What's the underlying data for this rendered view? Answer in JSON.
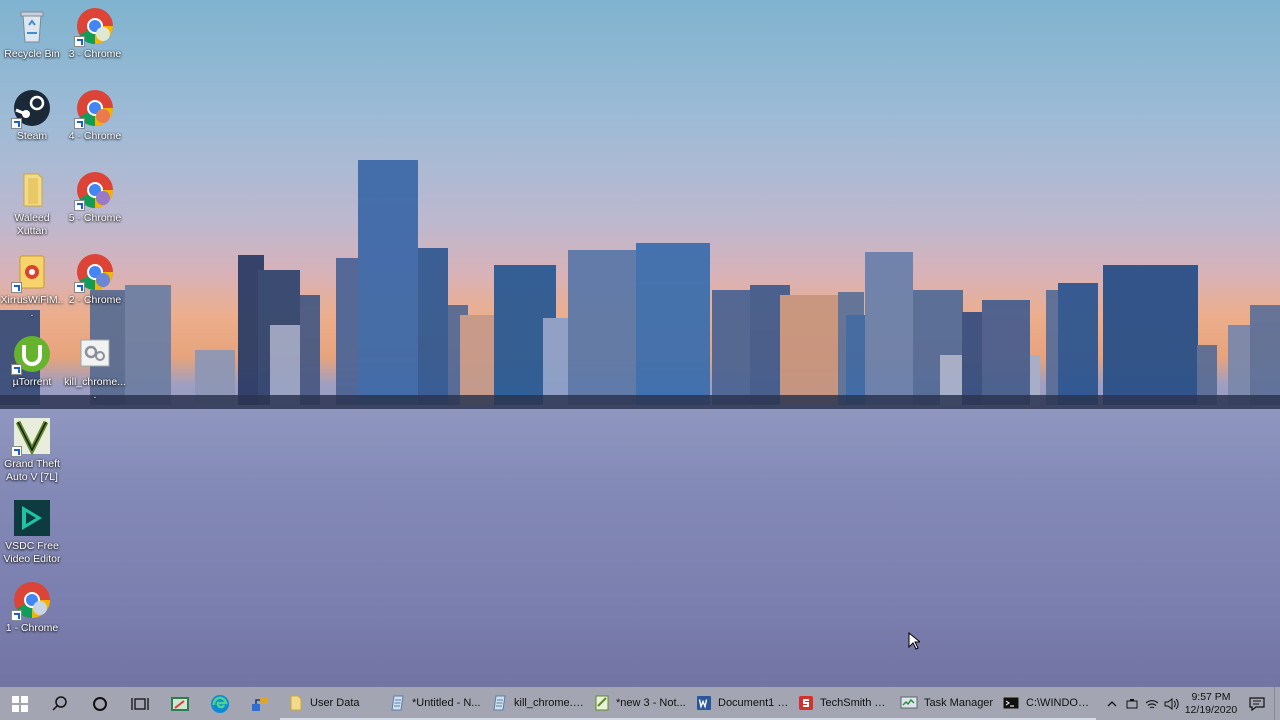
{
  "desktop": {
    "icons": [
      {
        "label": "Recycle Bin",
        "icon": "recycle-bin-icon"
      },
      {
        "label": "3 - Chrome",
        "icon": "chrome-icon"
      },
      {
        "label": "Steam",
        "icon": "steam-icon"
      },
      {
        "label": "4 - Chrome",
        "icon": "chrome-icon"
      },
      {
        "label": "Waleed Xuttan",
        "icon": "folder-icon"
      },
      {
        "label": "5 - Chrome",
        "icon": "chrome-icon"
      },
      {
        "label": "XirrusWiFiM...",
        "icon": "xirrus-icon"
      },
      {
        "label": "2 - Chrome",
        "icon": "chrome-icon"
      },
      {
        "label": "µTorrent",
        "icon": "utorrent-icon"
      },
      {
        "label": "kill_chrome....",
        "icon": "batch-file-icon"
      },
      {
        "label": "Grand Theft Auto V [7L]",
        "icon": "gta-icon"
      },
      {
        "label": "VSDC Free Video Editor",
        "icon": "vsdc-icon"
      },
      {
        "label": "1 - Chrome",
        "icon": "chrome-icon"
      }
    ]
  },
  "taskbar": {
    "apps": [
      {
        "label": "User Data",
        "icon": "folder-icon"
      },
      {
        "label": "*Untitled - N...",
        "icon": "notepad-icon"
      },
      {
        "label": "kill_chrome.b...",
        "icon": "notepad-icon"
      },
      {
        "label": "*new 3 - Not...",
        "icon": "notepadpp-icon"
      },
      {
        "label": "Document1 -...",
        "icon": "word-icon"
      },
      {
        "label": "TechSmith Sn...",
        "icon": "snagit-icon"
      },
      {
        "label": "Task Manager",
        "icon": "task-manager-icon"
      },
      {
        "label": "C:\\WINDOW...",
        "icon": "cmd-icon"
      }
    ],
    "clock": {
      "time": "9:57 PM",
      "date": "12/19/2020"
    }
  },
  "colors": {
    "taskbar": "#a3a6b2",
    "chrome_red": "#db4437",
    "chrome_green": "#0f9d58",
    "chrome_yellow": "#f4b400",
    "chrome_blue": "#4285f4"
  }
}
